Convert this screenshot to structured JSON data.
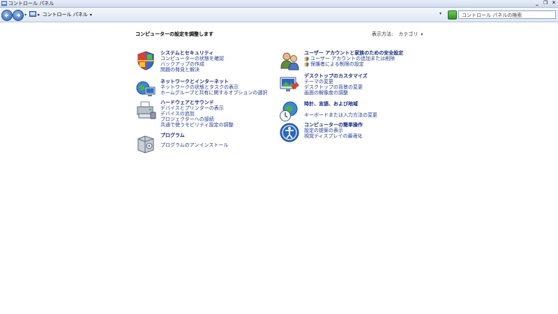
{
  "window": {
    "title": "コントロール パネル",
    "controls": {
      "minimize": "_",
      "restore": "❐",
      "close": "✕"
    }
  },
  "nav": {
    "breadcrumb": "コントロール パネル",
    "search_placeholder": "コントロール パネルの検索"
  },
  "content": {
    "heading": "コンピューターの設定を調整します",
    "view_by_label": "表示方法:",
    "view_by_value": "カテゴリ"
  },
  "categories": {
    "system": {
      "title": "システムとセキュリティ",
      "icon": "system-security-icon",
      "links": [
        "コンピューターの状態を確認",
        "バックアップの作成",
        "問題の発見と解決"
      ]
    },
    "network": {
      "title": "ネットワークとインターネット",
      "icon": "network-internet-icon",
      "links": [
        "ネットワークの状態とタスクの表示",
        "ホームグループと共有に関するオプションの選択"
      ]
    },
    "hardware": {
      "title": "ハードウェアとサウンド",
      "icon": "hardware-sound-icon",
      "links": [
        "デバイスとプリンターの表示",
        "デバイスの追加",
        "プロジェクターへの接続",
        "共通で使うモビリティ設定の調整"
      ]
    },
    "programs": {
      "title": "プログラム",
      "icon": "programs-icon",
      "links": [
        "プログラムのアンインストール"
      ]
    },
    "users": {
      "title": "ユーザー アカウントと家族のための安全設定",
      "icon": "user-accounts-icon",
      "links": [
        "ユーザー アカウントの追加または削除",
        "保護者による制限の設定"
      ]
    },
    "appearance": {
      "title": "デスクトップのカスタマイズ",
      "icon": "appearance-icon",
      "links": [
        "テーマの変更",
        "デスクトップの背景の変更",
        "画面の解像度の調整"
      ]
    },
    "clock": {
      "title": "時計、言語、および地域",
      "icon": "clock-language-region-icon",
      "links": [
        "キーボードまたは入力方法の変更"
      ]
    },
    "ease": {
      "title": "コンピューターの簡単操作",
      "icon": "ease-of-access-icon",
      "links": [
        "設定の提案の表示",
        "視覚ディスプレイの最適化"
      ]
    }
  }
}
